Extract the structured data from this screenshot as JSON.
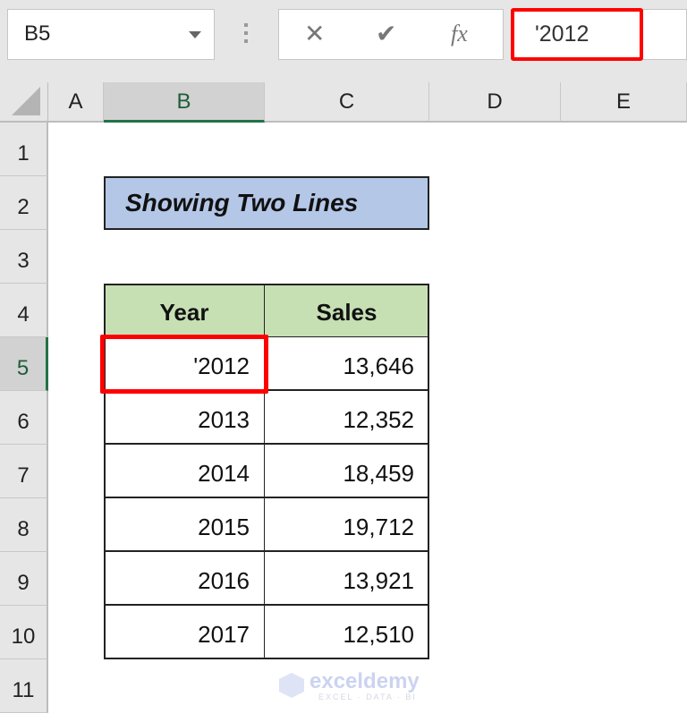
{
  "name_box": {
    "value": "B5"
  },
  "formula_bar": {
    "cancel_icon": "✕",
    "enter_icon": "✔",
    "fx_label": "fx",
    "value": "'2012"
  },
  "columns": [
    "A",
    "B",
    "C",
    "D",
    "E"
  ],
  "selected_column": "B",
  "rows": [
    "1",
    "2",
    "3",
    "4",
    "5",
    "6",
    "7",
    "8",
    "9",
    "10",
    "11"
  ],
  "selected_row": "5",
  "sheet": {
    "title": "Showing Two Lines",
    "table": {
      "headers": [
        "Year",
        "Sales"
      ],
      "rows": [
        [
          "'2012",
          "13,646"
        ],
        [
          "2013",
          "12,352"
        ],
        [
          "2014",
          "18,459"
        ],
        [
          "2015",
          "19,712"
        ],
        [
          "2016",
          "13,921"
        ],
        [
          "2017",
          "12,510"
        ]
      ]
    }
  },
  "watermark": {
    "name": "exceldemy",
    "tagline": "EXCEL · DATA · BI"
  },
  "colors": {
    "highlight": "#ff0000",
    "selection": "#217346",
    "title_fill": "#b4c7e7",
    "header_fill": "#c6e0b4"
  }
}
